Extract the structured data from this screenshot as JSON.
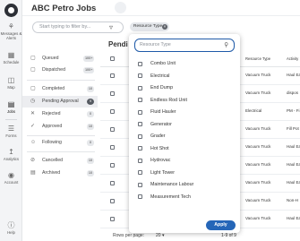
{
  "app": {
    "title": "ABC Petro Jobs"
  },
  "rail": [
    {
      "label": "Messages & Alerts",
      "icon": "bell-icon"
    },
    {
      "label": "Schedule",
      "icon": "calendar-icon"
    },
    {
      "label": "Map",
      "icon": "map-icon"
    },
    {
      "label": "Jobs",
      "icon": "jobs-icon"
    },
    {
      "label": "Forms",
      "icon": "forms-icon"
    },
    {
      "label": "Analytics",
      "icon": "chart-icon"
    },
    {
      "label": "Account",
      "icon": "user-icon"
    },
    {
      "label": "Help",
      "icon": "help-icon"
    }
  ],
  "toolbar": {
    "filter_placeholder": "Start typing to filter by...",
    "chip_label": "Resource Type"
  },
  "queues": [
    {
      "label": "Queued",
      "count": "100+",
      "icon": "queued-icon"
    },
    {
      "label": "Dispatched",
      "count": "100+",
      "icon": "dispatched-icon"
    },
    {
      "label": "Completed",
      "count": "10",
      "icon": "completed-icon"
    },
    {
      "label": "Pending Approval",
      "count": "9",
      "icon": "pending-icon"
    },
    {
      "label": "Rejected",
      "count": "0",
      "icon": "rejected-icon"
    },
    {
      "label": "Approved",
      "count": "10",
      "icon": "approved-icon"
    },
    {
      "label": "Following",
      "count": "0",
      "icon": "following-icon"
    },
    {
      "label": "Cancelled",
      "count": "10",
      "icon": "cancelled-icon"
    },
    {
      "label": "Archived",
      "count": "10",
      "icon": "archived-icon"
    }
  ],
  "table": {
    "title": "Pending Approval",
    "title_visible": "Pendi",
    "columns": [
      "Resource Type",
      "Activity"
    ],
    "rows": [
      {
        "resource_type": "Vacuum Truck",
        "activity": "Haul Ea"
      },
      {
        "resource_type": "Vacuum Truck",
        "activity": "dispos"
      },
      {
        "resource_type": "Electrical",
        "activity": "PM - Fi"
      },
      {
        "resource_type": "Vacuum Truck",
        "activity": "Fill Pot"
      },
      {
        "resource_type": "Vacuum Truck",
        "activity": "Haul Ea"
      },
      {
        "resource_type": "Vacuum Truck",
        "activity": "Haul Ea"
      },
      {
        "resource_type": "Vacuum Truck",
        "activity": "Haul Ea"
      },
      {
        "resource_type": "Vacuum Truck",
        "activity": "Non-H"
      },
      {
        "resource_type": "Vacuum Truck",
        "activity": "Haul Ea"
      }
    ]
  },
  "pager": {
    "rows_per_page_label": "Rows per page:",
    "rows_per_page_value": "20",
    "range": "1-9 of 9"
  },
  "popup": {
    "search_placeholder": "Resource Type",
    "options": [
      "Combo Unit",
      "Electrical",
      "End Dump",
      "Endless Rod Unit",
      "Fluid Hauler",
      "Generator",
      "Grader",
      "Hot Shot",
      "Hydrovac",
      "Light Tower",
      "Maintenance Labour",
      "Measurement Tech"
    ],
    "apply_label": "Apply"
  },
  "colors": {
    "accent": "#2566b8",
    "focus_border": "#1f5aa8"
  }
}
